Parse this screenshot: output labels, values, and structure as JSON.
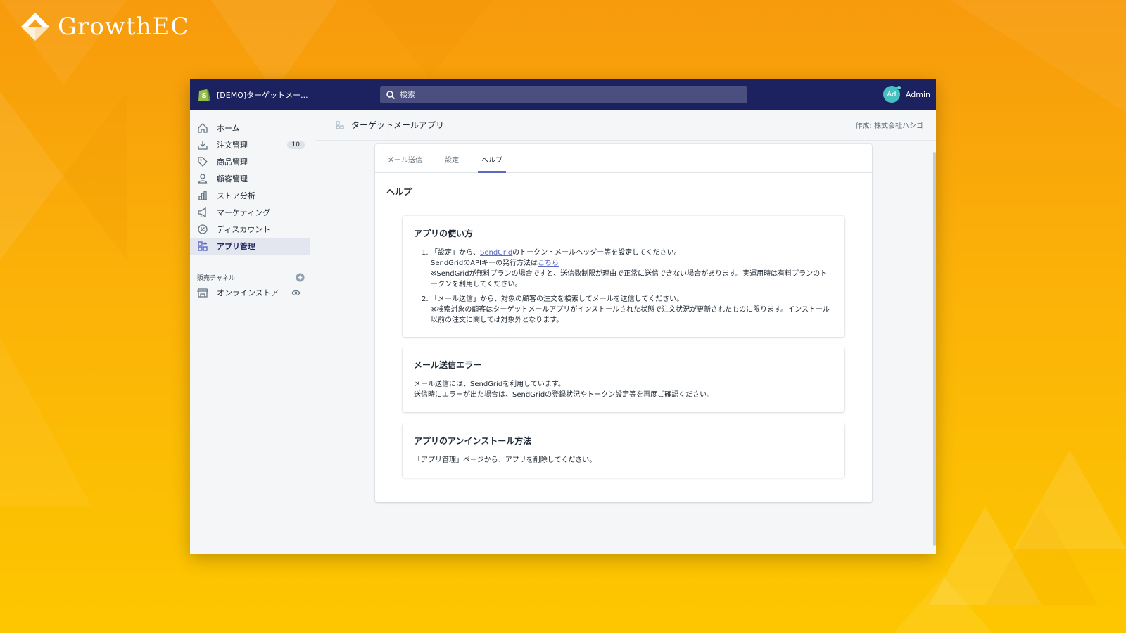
{
  "brand": {
    "name": "GrowthEC"
  },
  "topbar": {
    "store_name": "[DEMO]ターゲットメー...",
    "search_placeholder": "検索",
    "account": {
      "initials": "Ad",
      "name": "Admin"
    }
  },
  "sidebar": {
    "items": [
      {
        "label": "ホーム",
        "icon": "home-icon"
      },
      {
        "label": "注文管理",
        "icon": "orders-icon",
        "badge": "10"
      },
      {
        "label": "商品管理",
        "icon": "tag-icon"
      },
      {
        "label": "顧客管理",
        "icon": "person-icon"
      },
      {
        "label": "ストア分析",
        "icon": "analytics-icon"
      },
      {
        "label": "マーケティング",
        "icon": "megaphone-icon"
      },
      {
        "label": "ディスカウント",
        "icon": "discount-icon"
      },
      {
        "label": "アプリ管理",
        "icon": "apps-icon"
      }
    ],
    "channels_label": "販売チャネル",
    "channel": {
      "label": "オンラインストア",
      "icon": "store-icon"
    }
  },
  "page": {
    "title": "ターゲットメールアプリ",
    "author": "作成: 株式会社ハシゴ",
    "tabs": [
      "メール送信",
      "設定",
      "ヘルプ"
    ],
    "active_tab": "ヘルプ",
    "section_title": "ヘルプ"
  },
  "help": {
    "usage": {
      "title": "アプリの使い方",
      "step1_num": "1.",
      "step1_pre": "「設定」から、",
      "step1_link": "SendGrid",
      "step1_post": "のトークン・メールヘッダー等を設定してください。",
      "step1_line2_pre": "SendGridのAPIキーの発行方法は",
      "step1_line2_link": "こちら",
      "step1_line3": "※SendGridが無料プランの場合ですと、送信数制限が理由で正常に送信できない場合があります。実運用時は有料プランのトークンを利用してください。",
      "step2_num": "2.",
      "step2_line1": "「メール送信」から、対象の顧客の注文を検索してメールを送信してください。",
      "step2_line2": "※検索対象の顧客はターゲットメールアプリがインストールされた状態で注文状況が更新されたものに限ります。インストール以前の注文に関しては対象外となります。"
    },
    "error": {
      "title": "メール送信エラー",
      "line1": "メール送信には、SendGridを利用しています。",
      "line2": "送信時にエラーが出た場合は、SendGridの登録状況やトークン設定等を再度ご確認ください。"
    },
    "uninstall": {
      "title": "アプリのアンインストール方法",
      "line1": "「アプリ管理」ページから、アプリを削除してください。"
    }
  },
  "colors": {
    "topbar": "#1c2260",
    "accent": "#5c6ac4",
    "background_orange": "#f79a0c",
    "background_yellow": "#fdc700"
  }
}
